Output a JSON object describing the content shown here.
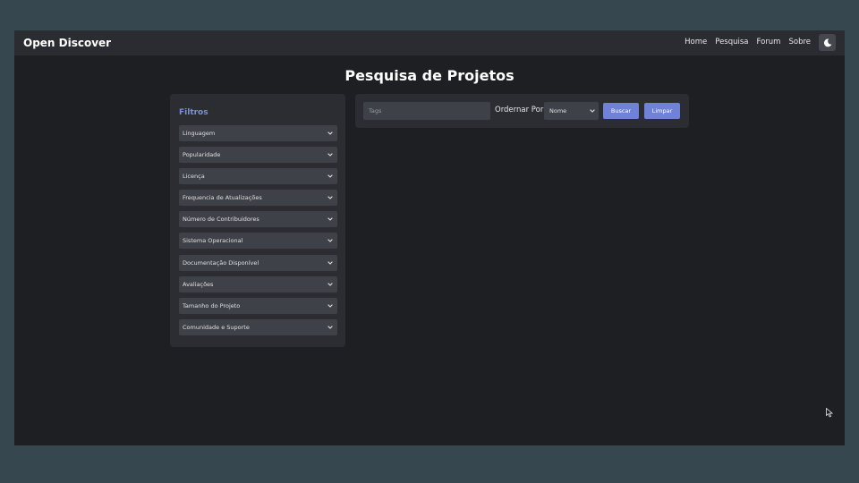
{
  "navbar": {
    "brand": "Open Discover",
    "links": [
      "Home",
      "Pesquisa",
      "Forum",
      "Sobre"
    ],
    "theme_toggle_icon": "moon-icon"
  },
  "page": {
    "title": "Pesquisa de Projetos"
  },
  "filters": {
    "title": "Filtros",
    "items": [
      "Linguagem",
      "Popularidade",
      "Licença",
      "Frequencia de Atualizações",
      "Número de Contribuidores",
      "Sistema Operacional",
      "Documentação Disponível",
      "Avaliações",
      "Tamanho do Projeto",
      "Comunidade e Suporte"
    ]
  },
  "search": {
    "tags_placeholder": "Tags",
    "tags_value": "",
    "order_label": "Ordernar Por",
    "order_value": "Nome",
    "search_button": "Buscar",
    "clear_button": "Limpar"
  },
  "colors": {
    "accent": "#7b8ee0",
    "button": "#6f82d8",
    "page_bg": "#1e1f23",
    "panel_bg": "#2c2d33",
    "navbar_bg": "#2b2c31",
    "outer_bg": "#37474f"
  }
}
